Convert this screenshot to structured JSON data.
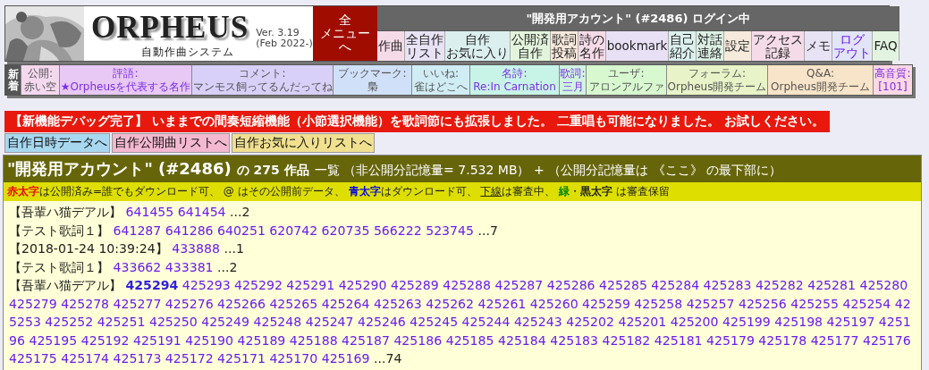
{
  "logo": {
    "title": "ORPHEUS",
    "subtitle": "自動作曲システム",
    "version": "Ver. 3.19",
    "date": "(Feb 2022-)"
  },
  "menu_button": [
    "全",
    "メニュー",
    "へ"
  ],
  "login_status": "\"開発用アカウント\" (#2486) ログイン中",
  "nav": [
    {
      "lines": [
        "作曲"
      ],
      "kind": "item"
    },
    {
      "lines": [
        "全自作",
        "リスト"
      ],
      "kind": "item"
    },
    {
      "lines": [
        "自作",
        "お気に入り"
      ],
      "kind": "item"
    },
    {
      "lines": [
        "公開済",
        "自作"
      ],
      "kind": "item"
    },
    {
      "lines": [
        "歌詞",
        "投稿"
      ],
      "kind": "item"
    },
    {
      "lines": [
        "詩の",
        "名作"
      ],
      "kind": "item"
    },
    {
      "lines": [
        "bookmark"
      ],
      "kind": "item"
    },
    {
      "lines": [
        "自己",
        "紹介"
      ],
      "kind": "item"
    },
    {
      "lines": [
        "対話",
        "連絡"
      ],
      "kind": "item"
    },
    {
      "lines": [
        "設定"
      ],
      "kind": "item"
    },
    {
      "lines": [
        "アクセス",
        "記録"
      ],
      "kind": "item"
    },
    {
      "lines": [
        "メモ"
      ],
      "kind": "item"
    },
    {
      "lines": [
        "ログ",
        "アウト"
      ],
      "kind": "link"
    },
    {
      "lines": [
        "FAQ"
      ],
      "kind": "item"
    }
  ],
  "news": {
    "label": "新着",
    "items": [
      {
        "label": "公開:",
        "value": "赤い空",
        "kind": "plain"
      },
      {
        "label": "評語:",
        "value": "★Orpheusを代表する名作",
        "kind": "link"
      },
      {
        "label": "コメント:",
        "value": "マンモス飼ってるんだってね",
        "kind": "plain"
      },
      {
        "label": "ブックマーク:",
        "value": "梟",
        "kind": "plain"
      },
      {
        "label": "いいね:",
        "value": "雀はどこへ",
        "kind": "plain"
      },
      {
        "label": "名詩:",
        "value": "Re:In Carnation",
        "kind": "link"
      },
      {
        "label": "歌詞:",
        "value": "三月",
        "kind": "link"
      },
      {
        "label": "ユーザ:",
        "value": "アロンアルファ",
        "kind": "plain"
      },
      {
        "label": "フォーラム:",
        "value": "Orpheus開発チーム",
        "kind": "plain"
      },
      {
        "label": "Q&A:",
        "value": "Orpheus開発チーム",
        "kind": "plain"
      },
      {
        "label": "高音質:",
        "value": "[101]",
        "kind": "link"
      }
    ]
  },
  "notice": "【新機能デバッグ完了】 いままでの間奏短縮機能（小節選択機能）を歌詞節にも拡張しました。 二重唱も可能になりました。 お試しください。",
  "quick_links": [
    "自作日時データへ",
    "自作公開曲リストへ",
    "自作お気に入りリストへ"
  ],
  "panel": {
    "title": "\"開発用アカウント\" (#2486)",
    "count": "の 275 作品",
    "note": "一覧 （非公開分記憶量= 7.532 MB） + （公開分記憶量は 《ここ》 の最下部に）",
    "legend": [
      {
        "text": "赤太字",
        "kind": "red"
      },
      {
        "text": "は公開済み=誰でもダウンロード可、 @ はその公開前データ、 ",
        "kind": "plain"
      },
      {
        "text": "青太字",
        "kind": "blue"
      },
      {
        "text": "はダウンロード可、 ",
        "kind": "plain"
      },
      {
        "text": "下線",
        "kind": "underline"
      },
      {
        "text": "は審査中、 ",
        "kind": "plain"
      },
      {
        "text": "緑",
        "kind": "green"
      },
      {
        "text": "・",
        "kind": "plain"
      },
      {
        "text": "黒太字",
        "kind": "bold"
      },
      {
        "text": " は審査保留",
        "kind": "plain"
      }
    ],
    "entries": [
      {
        "label": "【吾輩ハ猫デアル】",
        "ids": "641455 641454",
        "tail": "...2"
      },
      {
        "label": "【テスト歌詞１】",
        "ids": "641287 641286 640251 620742 620735 566222 523745",
        "tail": "...7"
      },
      {
        "label": "【2018-01-24 10:39:24】",
        "ids": "433888",
        "tail": "...1"
      },
      {
        "label": "【テスト歌詞１】",
        "ids": "433662 433381",
        "tail": "...2"
      },
      {
        "label": "【吾輩ハ猫デアル】",
        "ids": "**425294** 425293 425292 425291 425290 425289 425288 425287 425286 425285 425284 425283 425282 425281 425280 425279 425278 425277 425276 425266 425265 425264 425263 425262 425261 425260 425259 425258 425257 425256 425255 425254 425253 425252 425251 425250 425249 425248 425247 425246 425245 425244 425243 425202 425201 425200 425199 425198 425197 425196 425195 425192 425191 425190 425189 425188 425187 425186 425185 425184 425183 425182 425181 425179 425178 425177 425176 425175 425174 425173 425172 425171 425170 425169",
        "tail": "...74"
      }
    ]
  }
}
